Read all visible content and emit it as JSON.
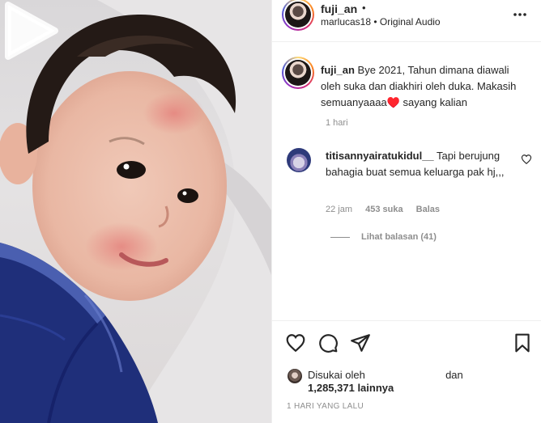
{
  "post": {
    "username": "fuji_an",
    "header_dot": "•",
    "subline": "marlucas18 • Original Audio",
    "caption_username": "fuji_an",
    "caption_text": "Bye 2021, Tahun dimana diawali oleh suka dan diakhiri oleh duka. Makasih semuanyaaaa♥️ sayang kalian",
    "caption_time": "1 hari"
  },
  "comment": {
    "username": "titisannyairatukidul__",
    "text": "Tapi berujung bahagia buat semua keluarga pak hj,,,",
    "time": "22 jam",
    "likes": "453 suka",
    "reply_label": "Balas",
    "view_replies": "Lihat balasan (41)"
  },
  "footer": {
    "liked_by_prefix": "Disukai oleh",
    "liked_by_and": "dan",
    "likes_count": "1,285,371 lainnya",
    "post_time": "1 HARI YANG LALU"
  },
  "icons": {
    "play": "play-icon",
    "more": "more-options-icon",
    "like": "heart-icon",
    "comment": "comment-icon",
    "share": "share-icon",
    "save": "bookmark-icon"
  },
  "colors": {
    "text": "#262626",
    "secondary": "#8e8e8e",
    "border": "#efefef",
    "shirt": "#1f2f7a"
  }
}
